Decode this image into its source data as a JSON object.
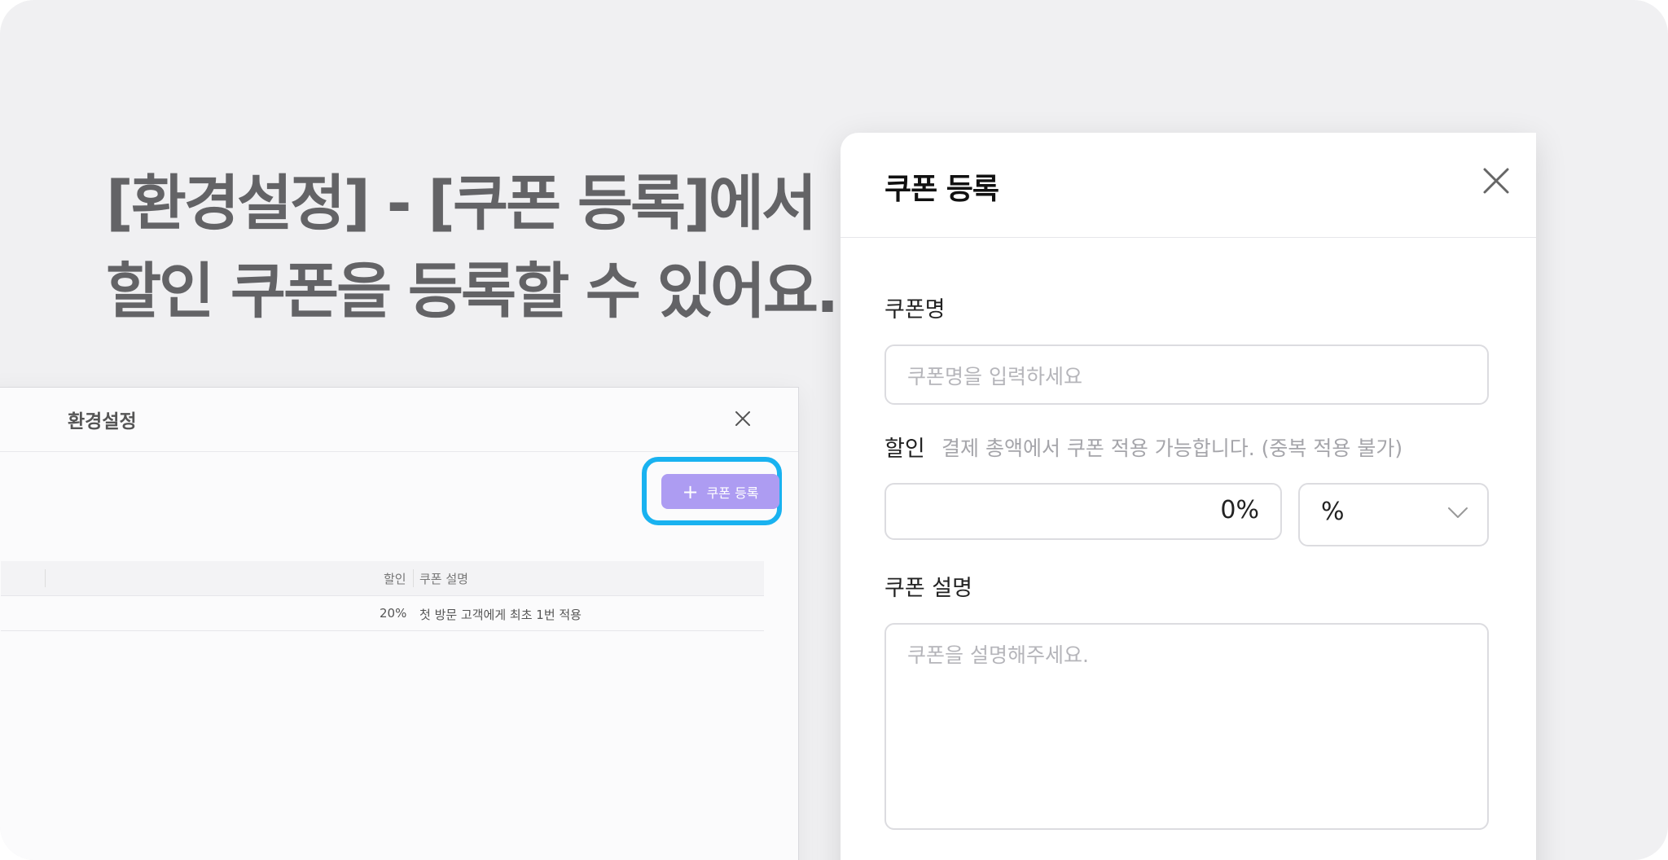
{
  "headline": {
    "line1": "[환경설정] - [쿠폰 등록]에서",
    "line2": "할인 쿠폰을 등록할 수 있어요."
  },
  "settings_window": {
    "title": "환경설정",
    "register_button": {
      "icon": "plus-icon",
      "label": "쿠폰 등록"
    },
    "table": {
      "columns": [
        "할인",
        "쿠폰 설명"
      ],
      "rows": [
        {
          "discount": "20%",
          "description": "첫 방문 고객에게 최초 1번 적용"
        }
      ]
    }
  },
  "coupon_modal": {
    "title": "쿠폰 등록",
    "name_label": "쿠폰명",
    "name_placeholder": "쿠폰명을 입력하세요",
    "discount_label": "할인",
    "discount_hint": "결제 총액에서 쿠폰 적용 가능합니다. (중복 적용 불가)",
    "discount_value": "0%",
    "discount_unit": "%",
    "description_label": "쿠폰 설명",
    "description_placeholder": "쿠폰을 설명해주세요."
  },
  "colors": {
    "background": "#f0f0f2",
    "headline": "#636366",
    "button": "#ad9cf2",
    "highlight": "#19b2f0"
  }
}
